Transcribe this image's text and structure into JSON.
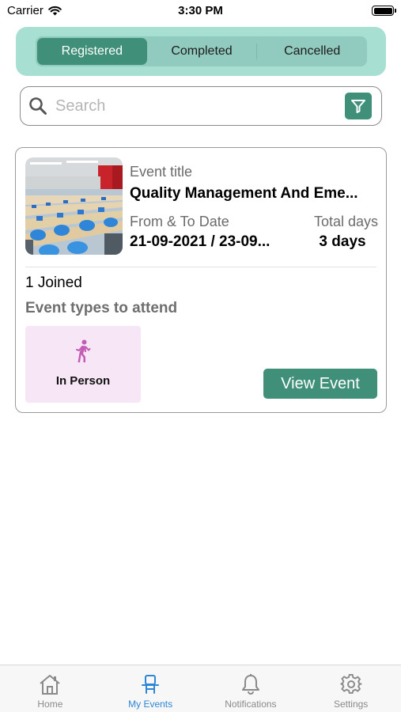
{
  "status_bar": {
    "carrier": "Carrier",
    "time": "3:30 PM"
  },
  "tabs": [
    {
      "label": "Registered",
      "active": true
    },
    {
      "label": "Completed",
      "active": false
    },
    {
      "label": "Cancelled",
      "active": false
    }
  ],
  "search": {
    "placeholder": "Search",
    "value": ""
  },
  "event_card": {
    "title_label": "Event title",
    "title": "Quality Management And Eme...",
    "dates_label": "From & To Date",
    "dates": "21-09-2021 / 23-09...",
    "days_label": "Total days",
    "days": "3 days",
    "joined": "1 Joined",
    "types_label": "Event types to attend",
    "types": [
      {
        "label": "In Person",
        "icon": "walking-person-icon"
      }
    ],
    "view_button": "View Event"
  },
  "tab_bar": [
    {
      "label": "Home",
      "icon": "home-icon",
      "active": false
    },
    {
      "label": "My Events",
      "icon": "chair-icon",
      "active": true
    },
    {
      "label": "Notifications",
      "icon": "bell-icon",
      "active": false
    },
    {
      "label": "Settings",
      "icon": "gear-icon",
      "active": false
    }
  ],
  "colors": {
    "accent": "#3f8f79",
    "tab_container": "#a8dfd3",
    "active_tab_bar": "#2d86d6",
    "chip_background": "#f7e6f5",
    "chip_icon": "#c25cb4"
  }
}
